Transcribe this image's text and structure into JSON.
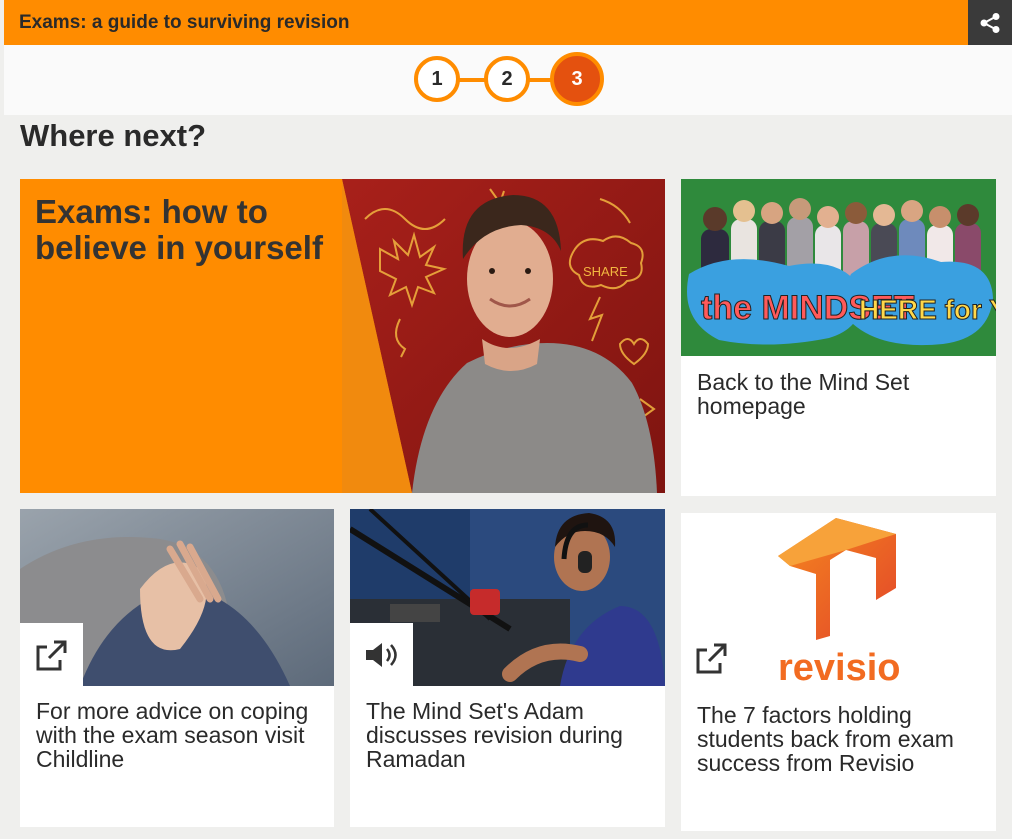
{
  "header": {
    "title": "Exams: a guide to surviving revision",
    "share_icon": "share-icon"
  },
  "stepper": {
    "steps": [
      "1",
      "2",
      "3"
    ],
    "active_step": 3
  },
  "section": {
    "heading": "Where next?"
  },
  "cards": {
    "feature": {
      "title": "Exams: how to believe in yourself",
      "doodle_text": "SHARE"
    },
    "mindset": {
      "text": "Back to the Mind Set homepage",
      "banner_left": "the MINDSET",
      "banner_right": "HERE for YOU"
    },
    "childline": {
      "text": "For more advice on coping with the exam season visit Childline",
      "icon": "external-link-icon"
    },
    "ramadan": {
      "text": "The Mind Set's Adam discusses revision during Ramadan",
      "icon": "speaker-icon"
    },
    "revisio": {
      "text": "The 7 factors holding students back from exam success from Revisio",
      "logo_text": "revisio",
      "icon": "external-link-icon"
    }
  },
  "colors": {
    "accent": "#ff8c00",
    "active_step": "#e4510f",
    "revisio_brand": "#f26b21"
  }
}
